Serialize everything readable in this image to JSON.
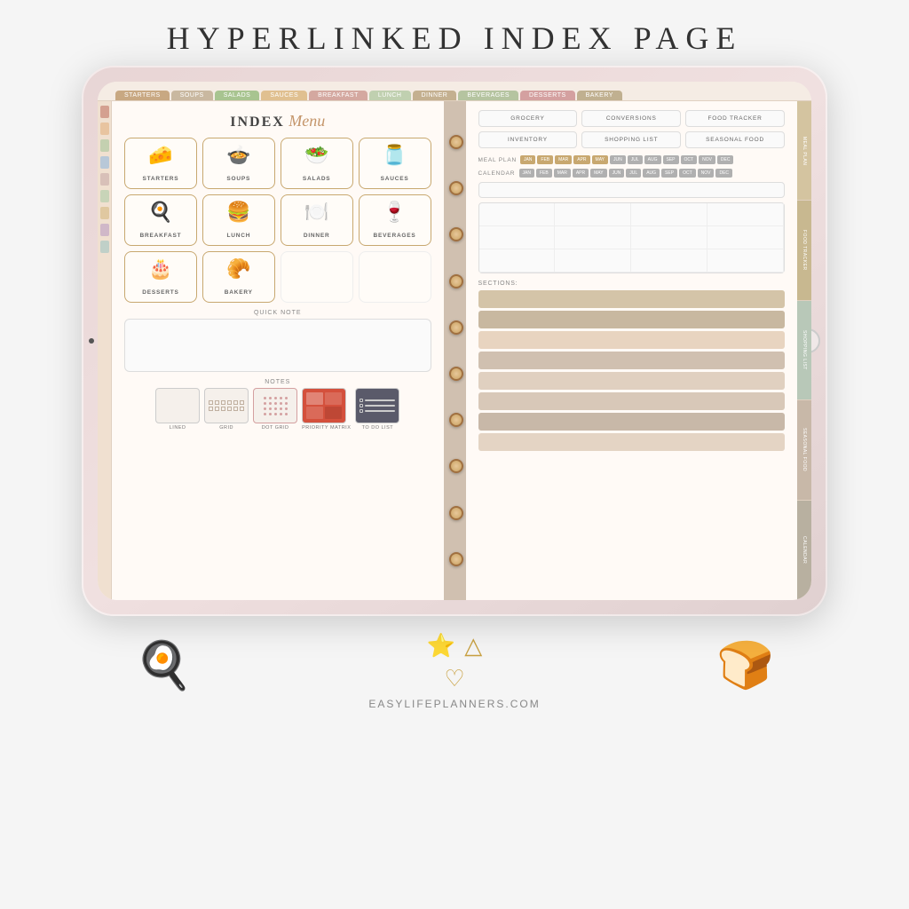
{
  "page": {
    "title": "HYPERLINKED INDEX PAGE",
    "website": "EASYLIFEPLANNERS.COM"
  },
  "tabs": {
    "top": [
      "STARTERS",
      "SOUPS",
      "SALADS",
      "SAUCES",
      "BREAKFAST",
      "LUNCH",
      "DINNER",
      "BEVERAGES",
      "DESSERTS",
      "BAKERY"
    ]
  },
  "left_page": {
    "index_word": "INDEX",
    "menu_word": "Menu",
    "food_items": [
      {
        "label": "STARTERS",
        "emoji": "🧀"
      },
      {
        "label": "SOUPS",
        "emoji": "🍲"
      },
      {
        "label": "SALADS",
        "emoji": "🥗"
      },
      {
        "label": "SAUCES",
        "emoji": "🫙"
      },
      {
        "label": "BREAKFAST",
        "emoji": "🍳"
      },
      {
        "label": "LUNCH",
        "emoji": "🍔"
      },
      {
        "label": "DINNER",
        "emoji": "🍽️"
      },
      {
        "label": "BEVERAGES",
        "emoji": "🍷"
      },
      {
        "label": "DESSERTS",
        "emoji": "🎂"
      },
      {
        "label": "BAKERY",
        "emoji": "🥐"
      }
    ],
    "quick_note_label": "QUICK NOTE",
    "notes_label": "NOTES",
    "note_types": [
      {
        "label": "LINED",
        "type": "lined"
      },
      {
        "label": "GRID",
        "type": "grid"
      },
      {
        "label": "DOT GRID",
        "type": "dot"
      },
      {
        "label": "PRIORITY MATRIX",
        "type": "priority"
      },
      {
        "label": "TO DO LIST",
        "type": "todo"
      }
    ]
  },
  "right_page": {
    "buttons": [
      "GROCERY",
      "CONVERSIONS",
      "FOOD TRACKER",
      "INVENTORY",
      "SHOPPING LIST",
      "SEASONAL FOOD"
    ],
    "meal_plan_label": "MEAL PLAN",
    "calendar_label": "CALENDAR",
    "months": [
      "JAN",
      "FEB",
      "MAR",
      "APR",
      "MAY",
      "JUN",
      "JUL",
      "AUG",
      "SEP",
      "OCT",
      "NOV",
      "DEC"
    ],
    "sections_label": "SECTIONS:",
    "section_colors": [
      "#d4c4a8",
      "#c8b8a0",
      "#e8d4c0",
      "#d0c0b0",
      "#e0d0c0",
      "#d8c8b8",
      "#c8b8a8",
      "#e4d4c4"
    ]
  },
  "right_side_tabs": [
    "MEAL PLAN",
    "FOOD TRACKER",
    "SHOPPING LIST",
    "SEASONAL FOOD",
    "CALENDAR"
  ],
  "bottom_icons": {
    "left_emoji": "🍳",
    "middle_top_emojis": [
      "⭐",
      "△"
    ],
    "middle_bottom_emoji": "♡",
    "right_emoji": "🍞"
  }
}
